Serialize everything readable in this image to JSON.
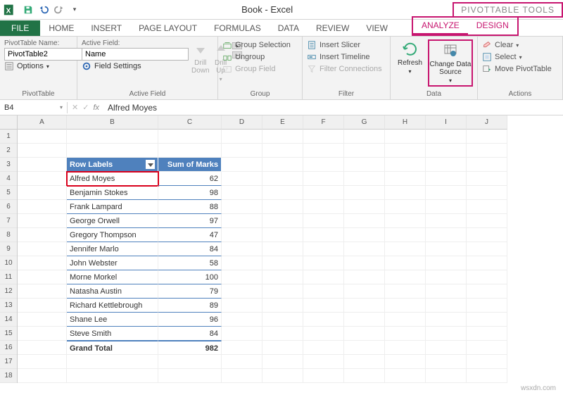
{
  "title": "Book - Excel",
  "context_title": "PIVOTTABLE TOOLS",
  "tabs": {
    "file": "FILE",
    "home": "HOME",
    "insert": "INSERT",
    "page_layout": "PAGE LAYOUT",
    "formulas": "FORMULAS",
    "data": "DATA",
    "review": "REVIEW",
    "view": "VIEW",
    "analyze": "ANALYZE",
    "design": "DESIGN"
  },
  "ribbon": {
    "pivot": {
      "name_lbl": "PivotTable Name:",
      "name_val": "PivotTable2",
      "options": "Options",
      "group": "PivotTable"
    },
    "active": {
      "field_lbl": "Active Field:",
      "field_val": "Name",
      "settings": "Field Settings",
      "drill_down": "Drill\nDown",
      "drill_up": "Drill\nUp",
      "group": "Active Field"
    },
    "grouping": {
      "sel": "Group Selection",
      "ungroup": "Ungroup",
      "field": "Group Field",
      "group": "Group"
    },
    "filter": {
      "slicer": "Insert Slicer",
      "timeline": "Insert Timeline",
      "conn": "Filter Connections",
      "group": "Filter"
    },
    "data": {
      "refresh": "Refresh",
      "source": "Change Data\nSource",
      "group": "Data"
    },
    "actions": {
      "clear": "Clear",
      "select": "Select",
      "move": "Move PivotTable",
      "group": "Actions"
    }
  },
  "namebox": "B4",
  "fx_value": "Alfred Moyes",
  "col_heads": [
    "A",
    "B",
    "C",
    "D",
    "E",
    "F",
    "G",
    "H",
    "I",
    "J"
  ],
  "row_heads": [
    1,
    2,
    3,
    4,
    5,
    6,
    7,
    8,
    9,
    10,
    11,
    12,
    13,
    14,
    15,
    16,
    17,
    18
  ],
  "pivot": {
    "hdr_labels": "Row Labels",
    "hdr_sum": "Sum of Marks",
    "rows": [
      {
        "label": "Alfred Moyes",
        "val": 62,
        "selected": true
      },
      {
        "label": "Benjamin Stokes",
        "val": 98
      },
      {
        "label": "Frank Lampard",
        "val": 88
      },
      {
        "label": "George Orwell",
        "val": 97
      },
      {
        "label": "Gregory Thompson",
        "val": 47
      },
      {
        "label": "Jennifer Marlo",
        "val": 84
      },
      {
        "label": "John Webster",
        "val": 58
      },
      {
        "label": "Morne Morkel",
        "val": 100
      },
      {
        "label": "Natasha Austin",
        "val": 79
      },
      {
        "label": "Richard Kettlebrough",
        "val": 89
      },
      {
        "label": "Shane Lee",
        "val": 96
      },
      {
        "label": "Steve Smith",
        "val": 84
      }
    ],
    "grand_label": "Grand Total",
    "grand_val": 982
  },
  "watermark": "wsxdn.com"
}
